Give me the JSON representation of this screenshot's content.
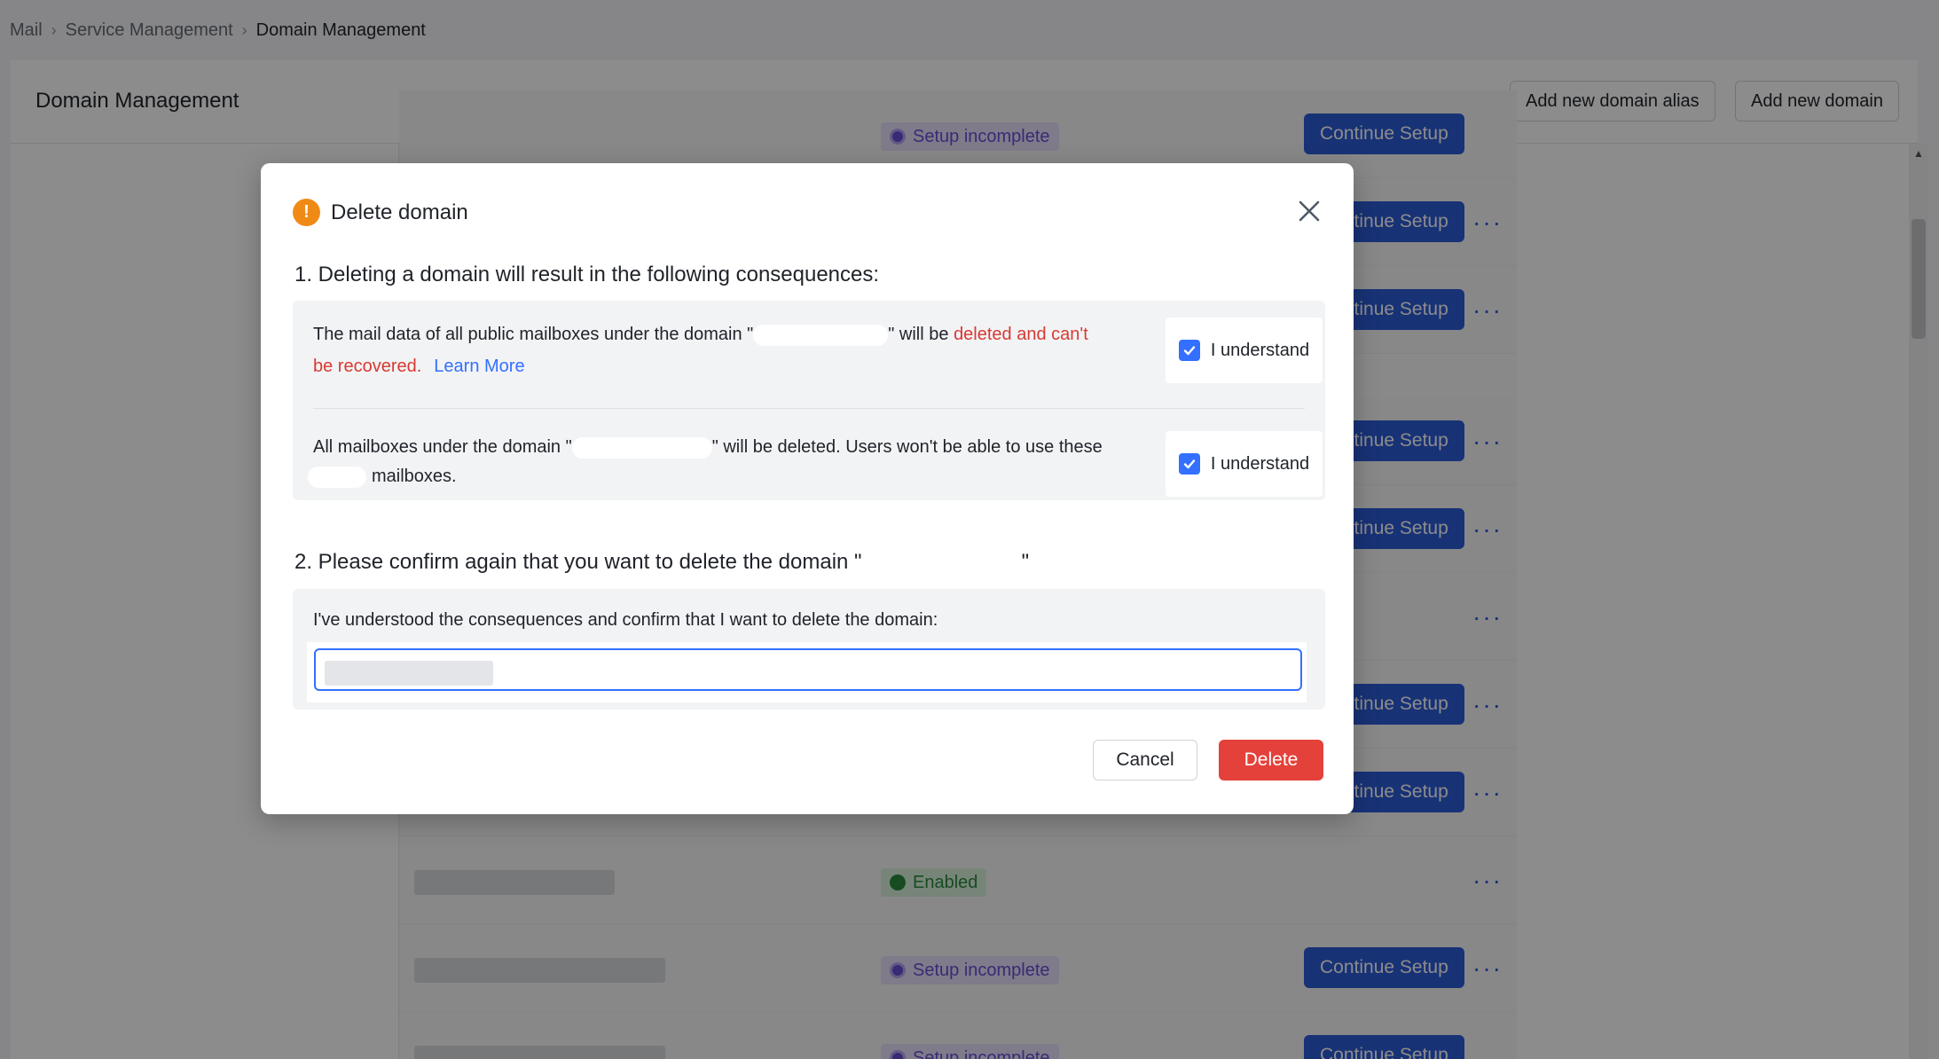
{
  "breadcrumb": {
    "items": [
      "Mail",
      "Service Management",
      "Domain Management"
    ]
  },
  "header": {
    "title": "Domain Management",
    "add_alias_label": "Add new domain alias",
    "add_domain_label": "Add new domain"
  },
  "table": {
    "continue_label": "Continue Setup",
    "status_enabled": "Enabled",
    "status_incomplete": "Setup incomplete",
    "more_label": "···"
  },
  "modal": {
    "title": "Delete domain",
    "section1": "1. Deleting a domain will result in the following consequences:",
    "item1_pre": "The mail data of all public mailboxes under the domain \"",
    "item1_mid": "\" will be ",
    "item1_danger1": "deleted and can't",
    "item1_danger2": "be recovered.",
    "learn_more": "Learn More",
    "item2_pre": "All mailboxes under the domain \"",
    "item2_mid": "\" will be deleted. Users won't be able to use these",
    "item2_end": "mailboxes.",
    "understand_label": "I understand",
    "section2_pre": "2. Please confirm again that you want to delete the domain \"",
    "section2_post": "\"",
    "confirm_label": "I've understood the consequences and confirm that I want to delete the domain:",
    "cancel_label": "Cancel",
    "delete_label": "Delete"
  },
  "colors": {
    "primary": "#3370ff",
    "danger": "#d83931",
    "warning": "#f08a16",
    "continue_button": "#2d5bd8"
  }
}
